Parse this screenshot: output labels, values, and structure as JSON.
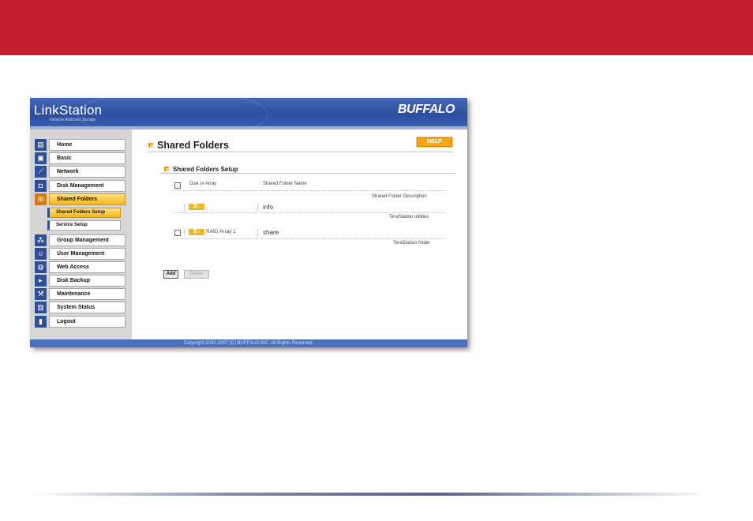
{
  "app": {
    "brand": "LinkStation",
    "brand_sub": "Network Attached Storage",
    "logo": "BUFFALO"
  },
  "sidebar": {
    "items": [
      {
        "label": "Home",
        "icon": "home-icon"
      },
      {
        "label": "Basic",
        "icon": "basic-icon"
      },
      {
        "label": "Network",
        "icon": "network-icon"
      },
      {
        "label": "Disk Management",
        "icon": "disk-icon"
      },
      {
        "label": "Shared Folders",
        "icon": "shared-folders-icon",
        "active": true
      },
      {
        "label": "Group Management",
        "icon": "group-icon"
      },
      {
        "label": "User Management",
        "icon": "user-icon"
      },
      {
        "label": "Web Access",
        "icon": "web-access-icon"
      },
      {
        "label": "Disk Backup",
        "icon": "backup-icon"
      },
      {
        "label": "Maintenance",
        "icon": "maintenance-icon"
      },
      {
        "label": "System Status",
        "icon": "system-status-icon"
      },
      {
        "label": "Logout",
        "icon": "logout-icon"
      }
    ],
    "subitems": [
      {
        "label": "Shared Folders Setup",
        "active": true
      },
      {
        "label": "Service Setup"
      }
    ]
  },
  "main": {
    "title": "Shared Folders",
    "help_label": "HELP",
    "section_title": "Shared Folders Setup",
    "table": {
      "col_disk": "Disk or Array",
      "col_name": "Shared Folder Name",
      "col_desc": "Shared Folder Description",
      "rows": [
        {
          "disk": "",
          "name": "info",
          "description": "TeraStation utilities",
          "has_checkbox": false
        },
        {
          "disk": "RAID Array 1",
          "name": "share",
          "description": "TeraStation folder",
          "has_checkbox": true
        }
      ]
    },
    "add_label": "Add",
    "delete_label": "Delete"
  },
  "footer": {
    "copyright": "Copyright 2002-2007 (C) BUFFALO INC. All Rights Reserved."
  },
  "colors": {
    "slide_red": "#c41e2a",
    "header_blue": "#2b4e9f",
    "accent_orange": "#f8a814"
  }
}
